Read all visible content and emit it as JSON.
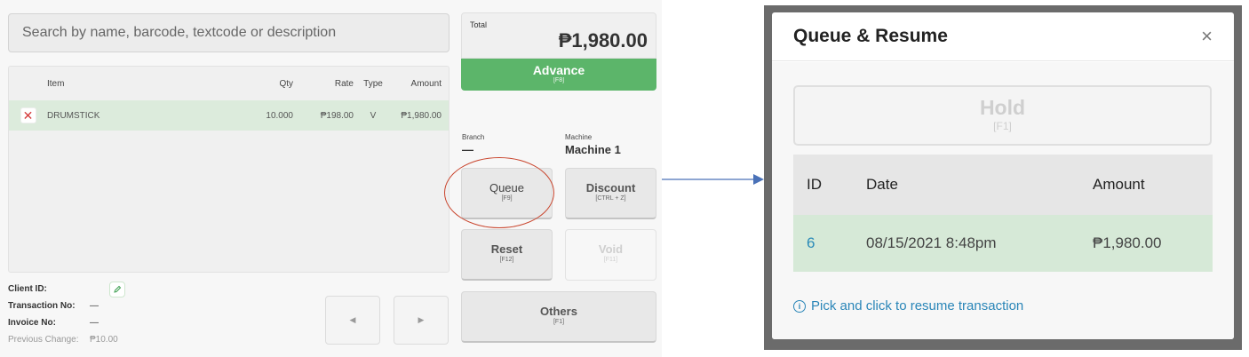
{
  "search": {
    "placeholder": "Search by name, barcode, textcode or description"
  },
  "table": {
    "headers": {
      "item": "Item",
      "qty": "Qty",
      "rate": "Rate",
      "type": "Type",
      "amount": "Amount"
    },
    "rows": [
      {
        "item": "DRUMSTICK",
        "qty": "10.000",
        "rate": "₱198.00",
        "type": "V",
        "amount": "₱1,980.00"
      }
    ]
  },
  "info": {
    "client_id_label": "Client ID:",
    "transaction_label": "Transaction No:",
    "transaction_value": "—",
    "invoice_label": "Invoice No:",
    "invoice_value": "—",
    "prev_change_label": "Previous Change:",
    "prev_change_value": "₱10.00"
  },
  "total": {
    "label": "Total",
    "value": "₱1,980.00"
  },
  "advance": {
    "label": "Advance",
    "key": "[F8]"
  },
  "branch": {
    "label": "Branch",
    "value": "—"
  },
  "machine": {
    "label": "Machine",
    "value": "Machine 1"
  },
  "buttons": {
    "queue": {
      "label": "Queue",
      "key": "[F9]"
    },
    "discount": {
      "label": "Discount",
      "key": "[CTRL + Z]"
    },
    "reset": {
      "label": "Reset",
      "key": "[F12]"
    },
    "void": {
      "label": "Void",
      "key": "[F11]"
    },
    "others": {
      "label": "Others",
      "key": "[F1]"
    }
  },
  "modal": {
    "title": "Queue & Resume",
    "close": "×",
    "hold": {
      "label": "Hold",
      "key": "[F1]"
    },
    "headers": {
      "id": "ID",
      "date": "Date",
      "amount": "Amount"
    },
    "rows": [
      {
        "id": "6",
        "date": "08/15/2021 8:48pm",
        "amount": "₱1,980.00"
      }
    ],
    "hint": "Pick and click to resume transaction"
  },
  "colors": {
    "accent_green": "#5cb56a",
    "link_blue": "#2a86b8",
    "annotation_red": "#c9442c",
    "arrow_blue": "#4a72b8"
  }
}
